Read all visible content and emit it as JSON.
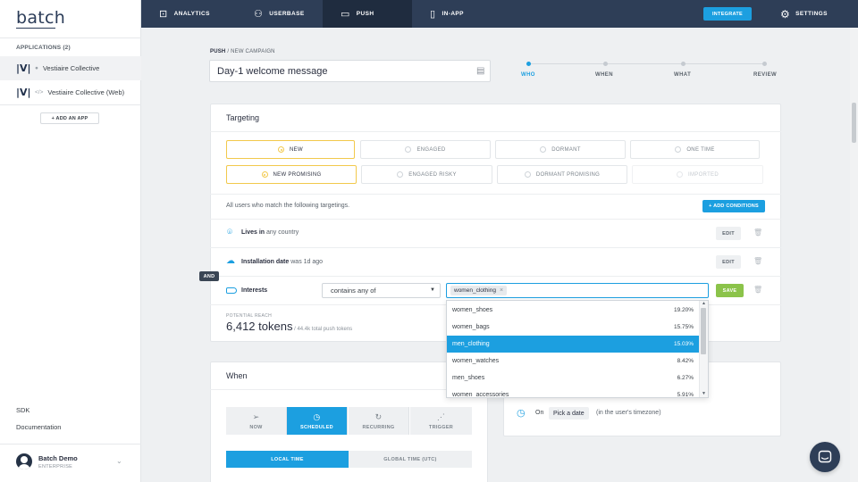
{
  "sidebar": {
    "logo": "batch",
    "applications_title": "APPLICATIONS (2)",
    "apps": [
      {
        "logo": "|V|",
        "platform_icon": "apple-icon",
        "platform_glyph": "●",
        "name": "Vestiaire Collective"
      },
      {
        "logo": "|V|",
        "platform_icon": "code-icon",
        "platform_glyph": "</>",
        "name": "Vestiaire Collective (Web)"
      }
    ],
    "add_app": "+ ADD AN APP",
    "links": [
      "SDK",
      "Documentation"
    ],
    "user": {
      "name": "Batch Demo",
      "plan": "ENTERPRISE"
    }
  },
  "topnav": {
    "items": [
      {
        "icon": "chart-icon",
        "glyph": "⊡",
        "label": "ANALYTICS"
      },
      {
        "icon": "users-icon",
        "glyph": "⚇",
        "label": "USERBASE"
      },
      {
        "icon": "message-icon",
        "glyph": "▭",
        "label": "PUSH"
      },
      {
        "icon": "phone-icon",
        "glyph": "▯",
        "label": "IN-APP"
      }
    ],
    "active": "PUSH",
    "integrate": "INTEGRATE",
    "settings": "SETTINGS"
  },
  "header": {
    "breadcrumb_root": "PUSH",
    "breadcrumb_sep": " / ",
    "breadcrumb_leaf": "NEW CAMPAIGN",
    "campaign_name": "Day-1 welcome message",
    "steps": [
      "WHO",
      "WHEN",
      "WHAT",
      "REVIEW"
    ],
    "active_step": "WHO"
  },
  "targeting": {
    "title": "Targeting",
    "segments": [
      {
        "label": "NEW",
        "selected": true
      },
      {
        "label": "ENGAGED",
        "selected": false
      },
      {
        "label": "DORMANT",
        "selected": false
      },
      {
        "label": "ONE TIME",
        "selected": false
      },
      {
        "label": "NEW PROMISING",
        "selected": true
      },
      {
        "label": "ENGAGED RISKY",
        "selected": false
      },
      {
        "label": "DORMANT PROMISING",
        "selected": false
      },
      {
        "label": "IMPORTED",
        "selected": false,
        "disabled": true
      }
    ],
    "conditions_intro": "All users who match the following targetings.",
    "add_conditions": "+ ADD CONDITIONS",
    "and_badge": "AND",
    "conditions": [
      {
        "icon": "location-icon",
        "glyph": "⌾",
        "bold": "Lives in",
        "rest": " any country",
        "edit": "EDIT"
      },
      {
        "icon": "cloud-icon",
        "glyph": "☁",
        "bold": "Installation date",
        "rest": " was 1d ago",
        "edit": "EDIT"
      }
    ],
    "interests": {
      "icon": "tag-icon",
      "label": "Interests",
      "operator": "contains any of",
      "tag": "women_clothing",
      "save": "SAVE"
    },
    "reach": {
      "label": "POTENTIAL REACH",
      "value": "6,412 tokens",
      "sub": " / 44.4k total push tokens"
    }
  },
  "dropdown": {
    "items": [
      {
        "name": "women_shoes",
        "pct": "19.20%"
      },
      {
        "name": "women_bags",
        "pct": "15.75%"
      },
      {
        "name": "men_clothing",
        "pct": "15.03%",
        "highlighted": true
      },
      {
        "name": "women_watches",
        "pct": "8.42%"
      },
      {
        "name": "men_shoes",
        "pct": "6.27%"
      },
      {
        "name": "women_accessories",
        "pct": "5.91%"
      }
    ]
  },
  "when": {
    "title": "When",
    "tabs": [
      {
        "icon": "send-icon",
        "glyph": "➢",
        "label": "NOW"
      },
      {
        "icon": "clock-icon",
        "glyph": "◷",
        "label": "SCHEDULED"
      },
      {
        "icon": "repeat-icon",
        "glyph": "↻",
        "label": "RECURRING"
      },
      {
        "icon": "signal-icon",
        "glyph": "⋰",
        "label": "TRIGGER"
      }
    ],
    "active_tab": "SCHEDULED",
    "time_tabs": [
      "LOCAL TIME",
      "GLOBAL TIME (UTC)"
    ],
    "active_time_tab": "LOCAL TIME",
    "on_label": "On",
    "pick_date": "Pick a date",
    "tz_note": "(in the user's timezone)"
  },
  "colors": {
    "accent": "#1c9fe0",
    "nav_bg": "#2e3e57",
    "selected_border": "#f2c94c",
    "save_green": "#8bc34a"
  }
}
